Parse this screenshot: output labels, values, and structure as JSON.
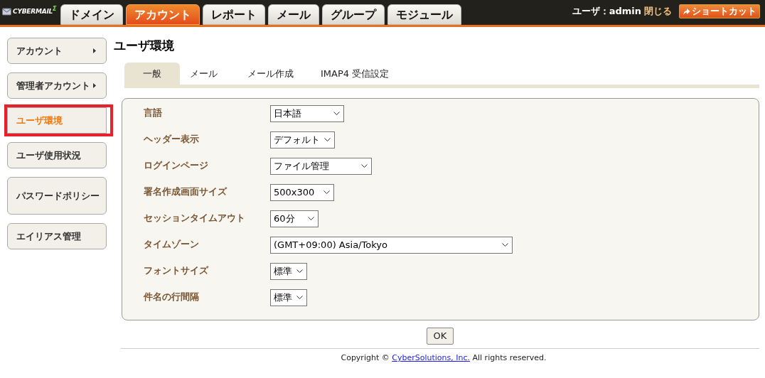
{
  "header": {
    "logo": "CYBERMAIL$^{Σ}$",
    "tabs": [
      {
        "label": "ドメイン",
        "selected": false
      },
      {
        "label": "アカウント",
        "selected": true
      },
      {
        "label": "レポート",
        "selected": false
      },
      {
        "label": "メール",
        "selected": false
      },
      {
        "label": "グループ",
        "selected": false
      },
      {
        "label": "モジュール",
        "selected": false
      }
    ],
    "user": "ユーザ：admin",
    "close": "閉じる",
    "shortcut": "ショートカット"
  },
  "sidebar": {
    "items": [
      {
        "label": "アカウント",
        "arrow": true,
        "selected": false,
        "highlighted": false
      },
      {
        "label": "管理者アカウント",
        "arrow": true,
        "selected": false,
        "highlighted": false
      },
      {
        "label": "ユーザ環境",
        "arrow": false,
        "selected": true,
        "highlighted": true
      },
      {
        "label": "ユーザ使用状況",
        "arrow": false,
        "selected": false,
        "highlighted": false
      },
      {
        "label": "パスワードポリシー",
        "arrow": false,
        "selected": false,
        "highlighted": false
      },
      {
        "label": "エイリアス管理",
        "arrow": false,
        "selected": false,
        "highlighted": false
      }
    ]
  },
  "page_title": "ユーザ環境",
  "subtabs": [
    {
      "label": "一般",
      "selected": true
    },
    {
      "label": "メール",
      "selected": false
    },
    {
      "label": "メール作成",
      "selected": false
    },
    {
      "label": "IMAP4 受信設定",
      "selected": false
    }
  ],
  "settings": [
    {
      "label": "言語",
      "value": "日本語"
    },
    {
      "label": "ヘッダー表示",
      "value": "デフォルト"
    },
    {
      "label": "ログインページ",
      "value": "ファイル管理"
    },
    {
      "label": "署名作成画面サイズ",
      "value": "500x300"
    },
    {
      "label": "セッションタイムアウト",
      "value": "60分"
    },
    {
      "label": "タイムゾーン",
      "value": "(GMT+09:00) Asia/Tokyo"
    },
    {
      "label": "フォントサイズ",
      "value": "標準"
    },
    {
      "label": "件名の行間隔",
      "value": "標準"
    }
  ],
  "ok_button": "OK",
  "footer": {
    "before": "Copyright © ",
    "link": "CyberSolutions, Inc.",
    "after": " All rights reserved."
  }
}
